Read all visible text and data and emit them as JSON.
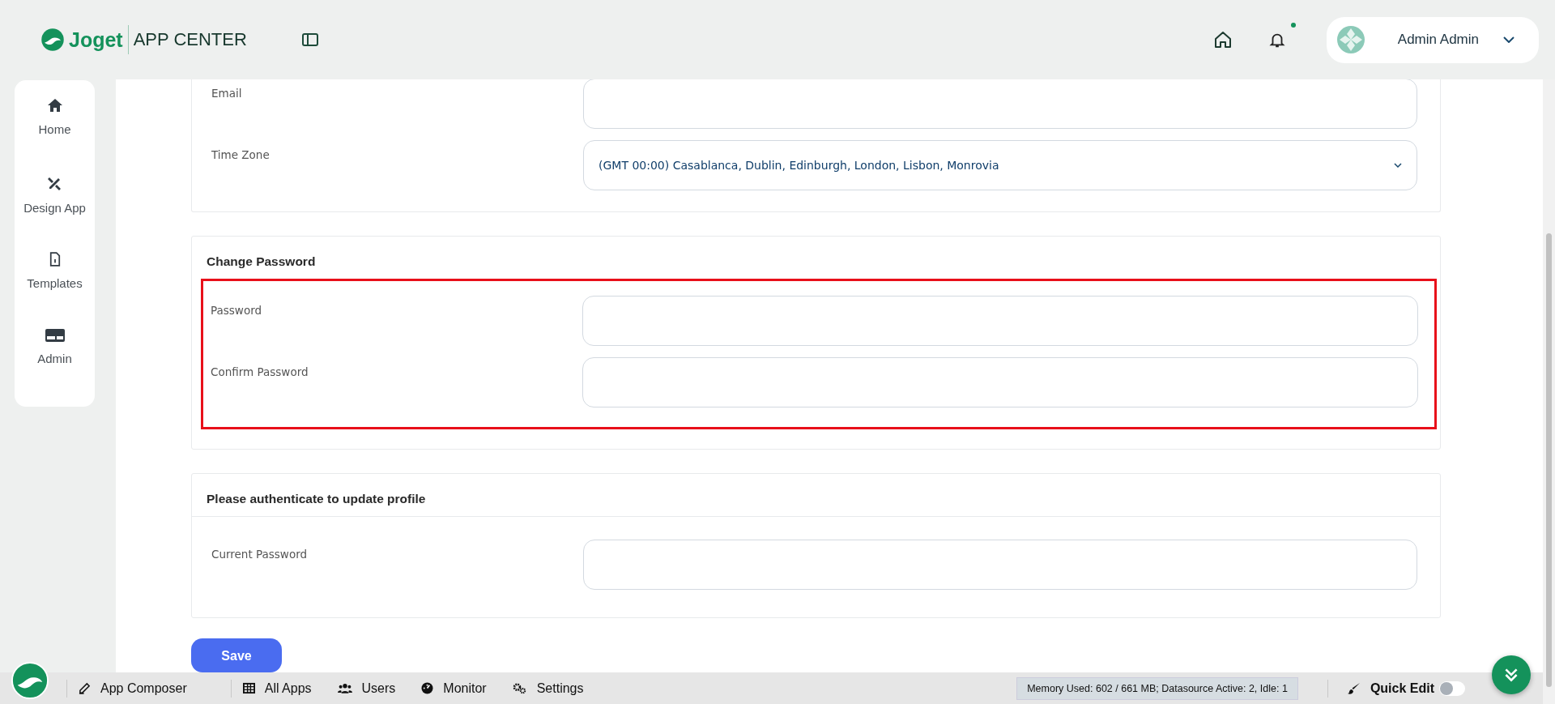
{
  "header": {
    "logo_text": "Joget",
    "app_title": "APP CENTER",
    "has_notification": true,
    "user_name": "Admin Admin"
  },
  "sidebar": {
    "items": [
      {
        "label": "Home",
        "kind": "home"
      },
      {
        "label": "Design App",
        "kind": "design"
      },
      {
        "label": "Templates",
        "kind": "template"
      },
      {
        "label": "Admin",
        "kind": "admin"
      }
    ]
  },
  "sections": [
    {
      "highlighted": false,
      "fields": [
        {
          "label": "Email",
          "kind": "text"
        },
        {
          "label": "Time Zone",
          "kind": "select",
          "value": "(GMT 00:00) Casablanca, Dublin, Edinburgh, London, Lisbon, Monrovia"
        }
      ]
    },
    {
      "heading": "Change Password",
      "highlighted": true,
      "fields": [
        {
          "label": "Password",
          "kind": "password"
        },
        {
          "label": "Confirm Password",
          "kind": "password"
        }
      ]
    },
    {
      "heading": "Please authenticate to update profile",
      "highlighted": false,
      "fields": [
        {
          "label": "Current Password",
          "kind": "password"
        }
      ]
    }
  ],
  "save_button": "Save",
  "bottom_bar": {
    "items": [
      {
        "label": "App Composer",
        "kind": "composer"
      },
      {
        "label": "All Apps",
        "kind": "apps"
      },
      {
        "label": "Users",
        "kind": "users"
      },
      {
        "label": "Monitor",
        "kind": "monitor"
      },
      {
        "label": "Settings",
        "kind": "settings"
      }
    ],
    "status": "Memory Used: 602 / 661 MB; Datasource Active: 2, Idle: 1",
    "quick_edit": {
      "label": "Quick Edit",
      "on": false
    }
  }
}
